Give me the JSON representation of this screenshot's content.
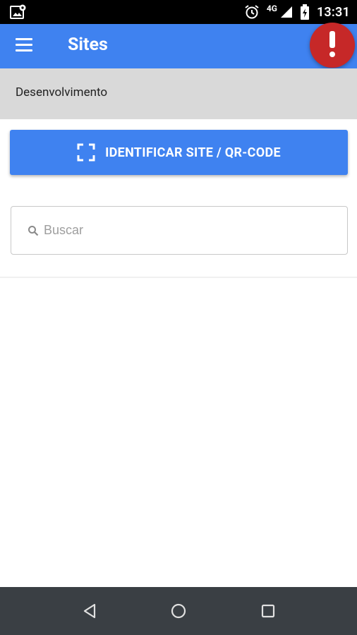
{
  "status_bar": {
    "time": "13:31",
    "network": "4G",
    "icons": [
      "gallery-notification-icon",
      "alarm-icon",
      "signal-icon",
      "battery-icon"
    ]
  },
  "app_bar": {
    "title": "Sites",
    "menu_icon": "hamburger-icon",
    "alert_icon": "exclamation-icon",
    "color": "#3f82f0",
    "alert_color": "#c62828"
  },
  "environment": {
    "label": "Desenvolvimento"
  },
  "identify_button": {
    "label": "IDENTIFICAR SITE / QR-CODE",
    "icon": "qr-scan-icon"
  },
  "search": {
    "placeholder": "Buscar",
    "value": "",
    "icon": "search-icon"
  },
  "nav_bar": {
    "buttons": [
      "back-icon",
      "home-icon",
      "recents-icon"
    ]
  }
}
